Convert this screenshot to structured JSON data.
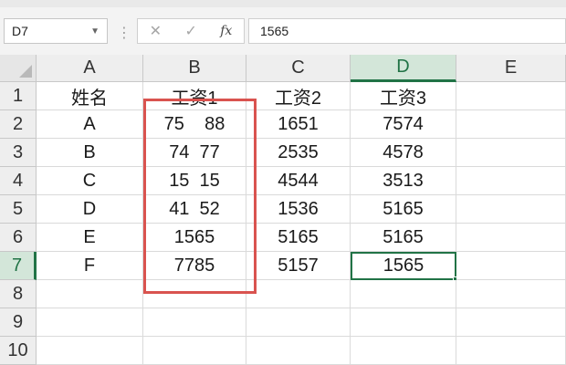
{
  "name_box": "D7",
  "formula": {
    "value": "1565",
    "fx_label": "fx",
    "cancel_glyph": "✕",
    "enter_glyph": "✓"
  },
  "columns": [
    "A",
    "B",
    "C",
    "D",
    "E"
  ],
  "rows": [
    "1",
    "2",
    "3",
    "4",
    "5",
    "6",
    "7",
    "8",
    "9",
    "10"
  ],
  "cells": [
    [
      "姓名",
      "工资1",
      "工资2",
      "工资3",
      ""
    ],
    [
      "A",
      "75    88",
      "1651",
      "7574",
      ""
    ],
    [
      "B",
      "74  77",
      "2535",
      "4578",
      ""
    ],
    [
      "C",
      "15  15",
      "4544",
      "3513",
      ""
    ],
    [
      "D",
      "41  52",
      "1536",
      "5165",
      ""
    ],
    [
      "E",
      "1565",
      "5165",
      "5165",
      ""
    ],
    [
      "F",
      "7785",
      "5157",
      "1565",
      ""
    ],
    [
      "",
      "",
      "",
      "",
      ""
    ],
    [
      "",
      "",
      "",
      "",
      ""
    ],
    [
      "",
      "",
      "",
      "",
      ""
    ]
  ],
  "selection": {
    "column": "D",
    "row": "7"
  },
  "colors": {
    "accent": "#217346",
    "highlight_box": "#d9534f"
  }
}
